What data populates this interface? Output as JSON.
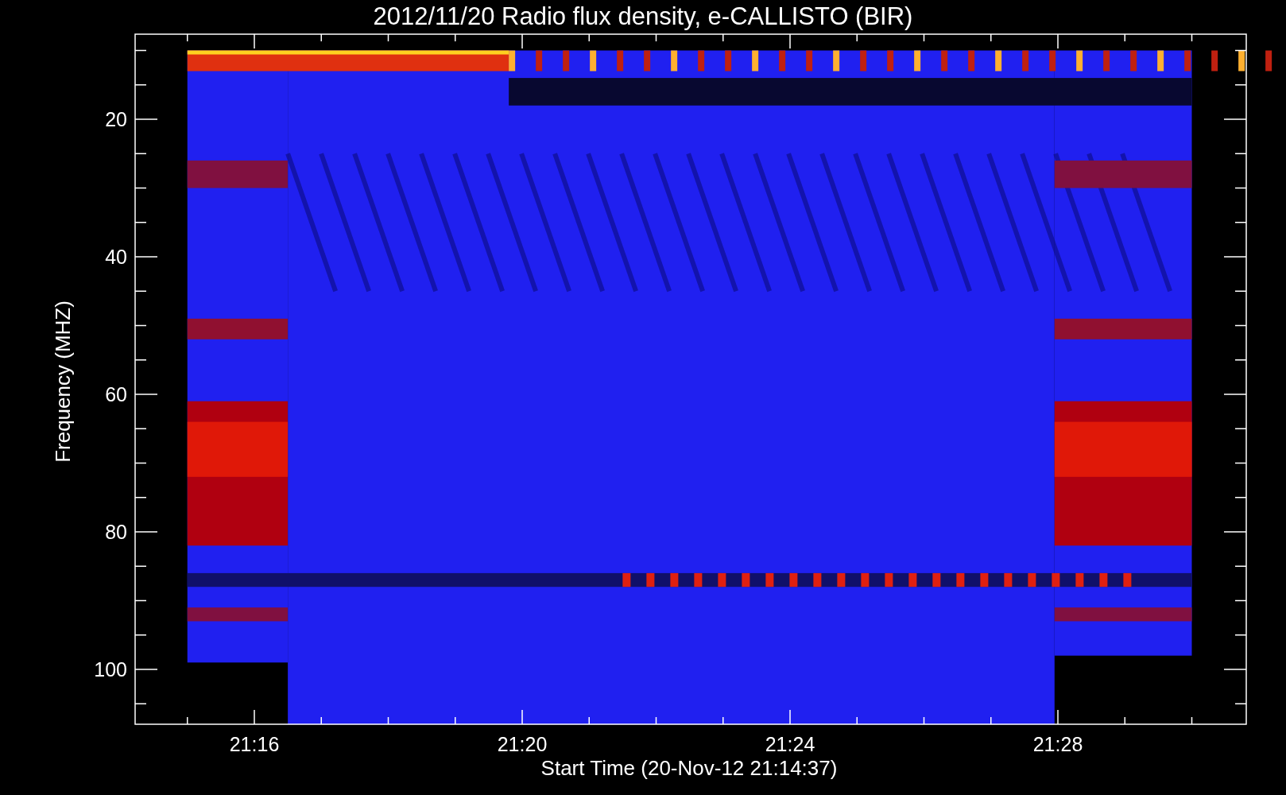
{
  "title": "2012/11/20  Radio flux density, e-CALLISTO (BIR)",
  "xlabel": "Start Time (20-Nov-12 21:14:37)",
  "ylabel": "Frequency (MHZ)",
  "xticks": [
    {
      "label": "21:16"
    },
    {
      "label": "21:20"
    },
    {
      "label": "21:24"
    },
    {
      "label": "21:28"
    }
  ],
  "yticks": [
    {
      "label": "20"
    },
    {
      "label": "40"
    },
    {
      "label": "60"
    },
    {
      "label": "80"
    },
    {
      "label": "100"
    }
  ]
}
